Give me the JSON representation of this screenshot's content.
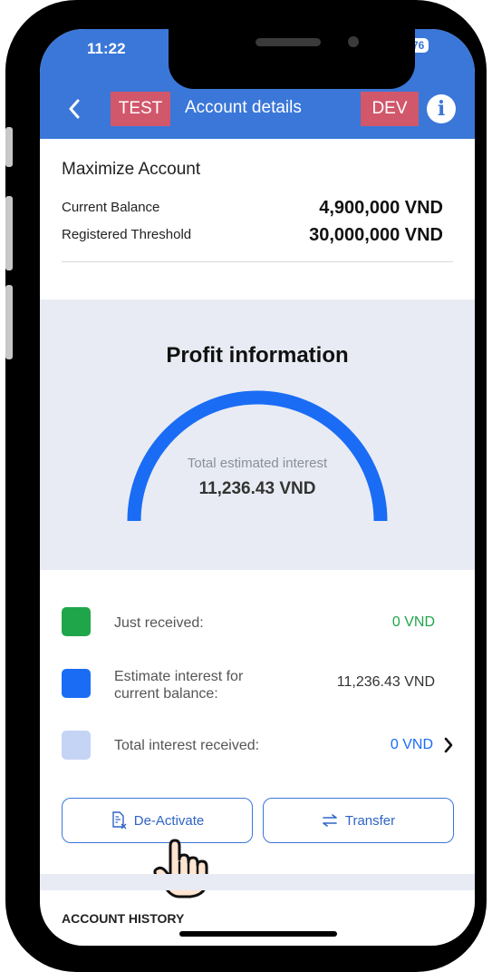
{
  "status_bar": {
    "time": "11:22",
    "battery": "76"
  },
  "header": {
    "env_left": "TEST",
    "title": "Account details",
    "env_right": "DEV",
    "info_glyph": "i",
    "back_icon": "chevron-left-icon",
    "info_icon": "info-circle-icon"
  },
  "account": {
    "name": "Maximize Account",
    "rows": [
      {
        "label": "Current Balance",
        "value": "4,900,000 VND"
      },
      {
        "label": "Registered Threshold",
        "value": "30,000,000 VND"
      }
    ]
  },
  "profit": {
    "title": "Profit information",
    "gauge_label": "Total estimated interest",
    "gauge_value": "11,236.43 VND",
    "gauge_fill": 1.0,
    "gauge_color": "#1a6cf5",
    "items": [
      {
        "label": "Just received:",
        "value": "0 VND",
        "swatch": "#1fa64a",
        "value_color": "#1fa64a"
      },
      {
        "label": "Estimate interest for\ncurrent balance:",
        "value": "11,236.43 VND",
        "swatch": "#1a6cf5",
        "value_color": "#333333"
      },
      {
        "label": "Total interest received:",
        "value": "0 VND",
        "swatch": "#c5d3f5",
        "value_color": "#1a6cf5"
      }
    ]
  },
  "actions": {
    "deactivate_label": "De-Activate",
    "transfer_label": "Transfer",
    "deactivate_icon": "document-x-icon",
    "transfer_icon": "swap-arrows-icon"
  },
  "history": {
    "title": "ACCOUNT HISTORY"
  },
  "colors": {
    "header_bg": "#3a77d8",
    "env_tag_bg": "#d1576b",
    "panel_bg": "#e8ebf3",
    "accent": "#2f63c6"
  }
}
